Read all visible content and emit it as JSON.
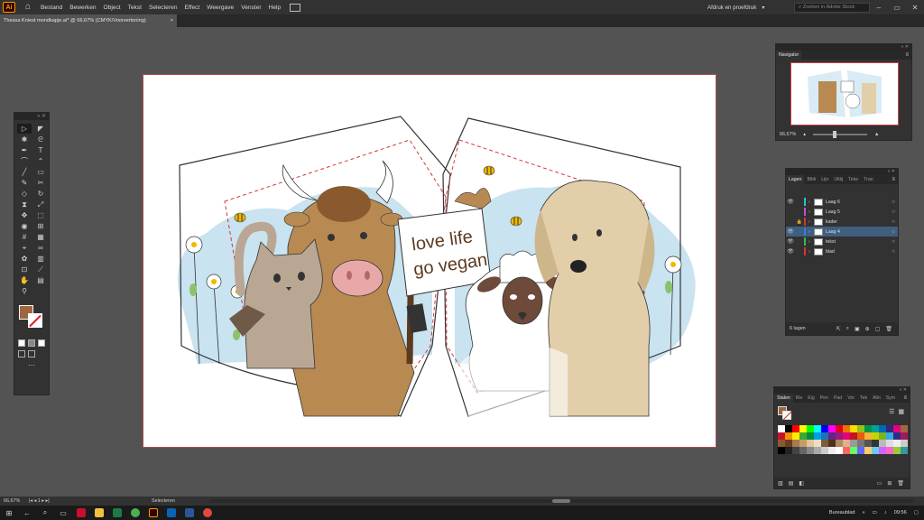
{
  "app": {
    "logo": "Ai",
    "menus": [
      "Bestand",
      "Bewerken",
      "Object",
      "Tekst",
      "Selecteren",
      "Effect",
      "Weergave",
      "Venster",
      "Help"
    ],
    "workspace": "Afdruk en proefdruk",
    "search_placeholder": "Zoeken in Adobe Stock"
  },
  "document": {
    "tab_title": "Thessa Kniest mondkapje.ai* @ 66,67% (CMYK/Voorvertoning)",
    "close_symbol": "×"
  },
  "artwork": {
    "sign_line1": "love life",
    "sign_line2": "go vegan",
    "colors": {
      "outline": "#333333",
      "seam": "#d23a3a",
      "sky": "#c9e3f0",
      "cow": "#b88a52",
      "cow_dark": "#8a5a2e",
      "cat": "#b9a794",
      "dog": "#e2cfaa",
      "sheep": "#ffffff",
      "sheep_face": "#6e4a3a",
      "nose_pink": "#e9a8a8",
      "stick": "#5c3a1e"
    }
  },
  "panels": {
    "navigator": {
      "title": "Navigator",
      "zoom": "66,67%"
    },
    "layers": {
      "tabs": [
        "Lagen",
        "Bibli",
        "Lijn",
        "Uitlij",
        "Teke",
        "Tran"
      ],
      "items": [
        {
          "name": "Laag 6",
          "color": "#24c7c7",
          "visible": true,
          "locked": false,
          "selected": false
        },
        {
          "name": "Laag 5",
          "color": "#c050d0",
          "visible": false,
          "locked": false,
          "selected": false
        },
        {
          "name": "kader",
          "color": "#e23030",
          "visible": false,
          "locked": true,
          "selected": false
        },
        {
          "name": "Laag 4",
          "color": "#3a7be0",
          "visible": true,
          "locked": false,
          "selected": true
        },
        {
          "name": "tekst",
          "color": "#30c040",
          "visible": true,
          "locked": false,
          "selected": false
        },
        {
          "name": "blad",
          "color": "#e23030",
          "visible": true,
          "locked": false,
          "selected": false
        }
      ],
      "count": "6 lagen"
    },
    "swatches": {
      "tabs": [
        "Stalen",
        "Kle",
        "Eig",
        "Pen",
        "Pad",
        "Vor",
        "Tek",
        "Alin",
        "Sym"
      ],
      "colors": [
        "#ffffff",
        "#000000",
        "#ff0000",
        "#ffff00",
        "#00ff00",
        "#00ffff",
        "#0000ff",
        "#ff00ff",
        "#e3001b",
        "#ee7203",
        "#ffde00",
        "#95c11f",
        "#009640",
        "#00a19a",
        "#0069b4",
        "#312783",
        "#e6007e",
        "#a0673e",
        "#c8102e",
        "#f39200",
        "#ffed00",
        "#3aaa35",
        "#008d36",
        "#009fe3",
        "#1d71b8",
        "#662483",
        "#951b81",
        "#e5007d",
        "#be1622",
        "#ea5b0c",
        "#f9b233",
        "#c6d300",
        "#7ab51d",
        "#36a9e1",
        "#2d2e83",
        "#a3195b",
        "#8b5a2b",
        "#6b3f1f",
        "#a67c52",
        "#c69c6d",
        "#e3c49b",
        "#f0dcc0",
        "#7a5c3a",
        "#4d3319",
        "#b08960",
        "#d9b38c",
        "#999999",
        "#777777",
        "#555555",
        "#333333",
        "#bbbbbb",
        "#dddddd",
        "#eeeeee",
        "#cccccc",
        "#000000",
        "#222222",
        "#444444",
        "#666666",
        "#888888",
        "#aaaaaa",
        "#cccccc",
        "#eeeeee",
        "#ffffff",
        "#ff6666",
        "#66ff66",
        "#6666ff",
        "#ffcc66",
        "#66ccff",
        "#cc66ff",
        "#ff66cc",
        "#99cc33",
        "#339999"
      ]
    }
  },
  "statusbar": {
    "zoom": "66,67%",
    "artboard": "1",
    "tool": "Selecteren"
  },
  "taskbar": {
    "desktop": "Bureaublad",
    "time": "09:56"
  }
}
